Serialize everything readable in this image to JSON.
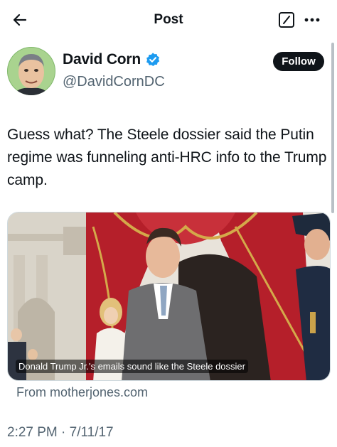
{
  "header": {
    "title": "Post"
  },
  "author": {
    "display_name": "David Corn",
    "handle": "@DavidCornDC",
    "follow_label": "Follow"
  },
  "tweet": {
    "text": "Guess what? The Steele dossier said the Putin regime was funneling anti-HRC info to the Trump camp.",
    "timestamp": "2:27 PM · 7/11/17"
  },
  "link_card": {
    "caption": "Donald Trump Jr.'s emails sound like the Steele dossier",
    "domain": "From motherjones.com"
  },
  "icons": {
    "back": "arrow-left-icon",
    "compose": "compose-icon",
    "more": "more-horizontal-icon",
    "verified": "verified-badge-icon"
  },
  "colors": {
    "text_primary": "#0f1419",
    "text_secondary": "#536471",
    "verified_blue": "#1d9bf0",
    "follow_bg": "#0f1419"
  }
}
